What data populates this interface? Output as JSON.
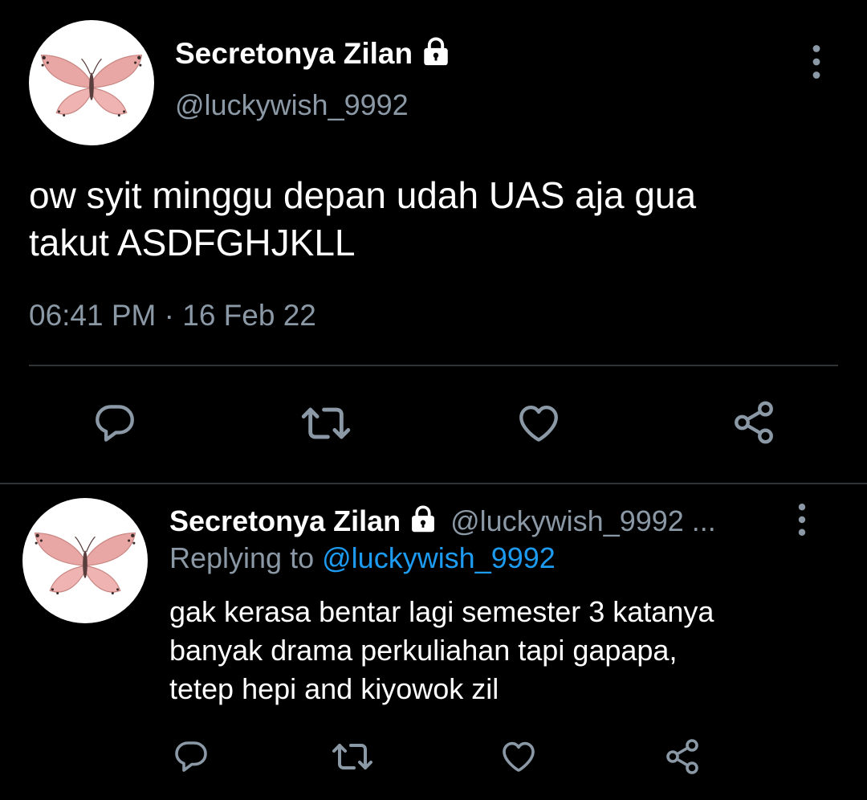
{
  "theme": {
    "background": "#000000",
    "text": "#ffffff",
    "muted": "#8b98a5",
    "link": "#1d9bf0",
    "divider": "#2f3336",
    "avatar_bg": "#ffffff",
    "butterfly": "#e8a6a4"
  },
  "main_tweet": {
    "author": {
      "display_name": "Secretonya Zilan",
      "handle": "@luckywish_9992",
      "avatar": "butterfly-avatar",
      "protected_icon": "lock-icon"
    },
    "more_icon": "vertical-dots-icon",
    "text_lines": [
      "ow syit minggu depan udah UAS aja gua",
      "takut ASDFGHJKLL"
    ],
    "meta": "06:41 PM · 16 Feb 22",
    "actions": [
      {
        "icon": "reply-icon"
      },
      {
        "icon": "retweet-icon"
      },
      {
        "icon": "like-icon"
      },
      {
        "icon": "share-icon"
      }
    ]
  },
  "reply_tweet": {
    "author": {
      "display_name": "Secretonya Zilan",
      "handle": "@luckywish_9992 ...",
      "avatar": "butterfly-avatar",
      "protected_icon": "lock-icon"
    },
    "more_icon": "vertical-dots-icon",
    "replying_to_label": "Replying to",
    "replying_to_handle": "@luckywish_9992",
    "text_lines": [
      "gak kerasa bentar lagi semester 3 katanya",
      "banyak drama perkuliahan tapi gapapa,",
      "tetep hepi and kiyowok zil"
    ],
    "actions": [
      {
        "icon": "reply-icon"
      },
      {
        "icon": "retweet-icon"
      },
      {
        "icon": "like-icon"
      },
      {
        "icon": "share-icon"
      }
    ]
  }
}
